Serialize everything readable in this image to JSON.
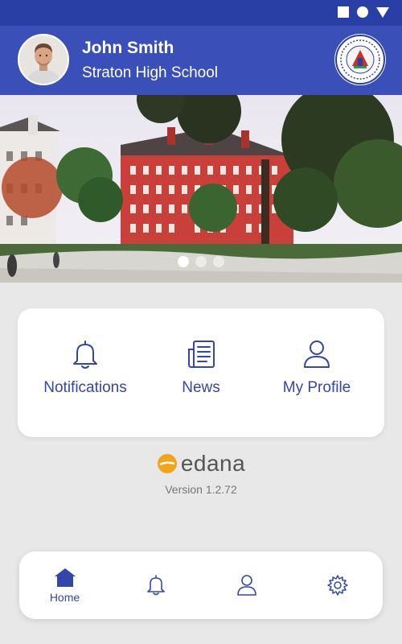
{
  "header": {
    "user_name": "John Smith",
    "school_name": "Straton High School"
  },
  "banner": {
    "slide_count": 3,
    "active_slide": 1
  },
  "quick_actions": [
    {
      "label": "Notifications",
      "icon": "bell-icon"
    },
    {
      "label": "News",
      "icon": "news-icon"
    },
    {
      "label": "My Profile",
      "icon": "profile-icon"
    }
  ],
  "brand": {
    "name": "edana",
    "version": "Version 1.2.72"
  },
  "bottom_nav": [
    {
      "label": "Home",
      "icon": "home-icon",
      "active": true
    },
    {
      "label": "",
      "icon": "bell-icon",
      "active": false
    },
    {
      "label": "",
      "icon": "profile-icon",
      "active": false
    },
    {
      "label": "",
      "icon": "settings-gear-icon",
      "active": false
    }
  ],
  "colors": {
    "status_bar": "#2a3fa6",
    "header": "#3a4fb8",
    "accent": "#3346aa",
    "brand_orange": "#f2a51a"
  }
}
